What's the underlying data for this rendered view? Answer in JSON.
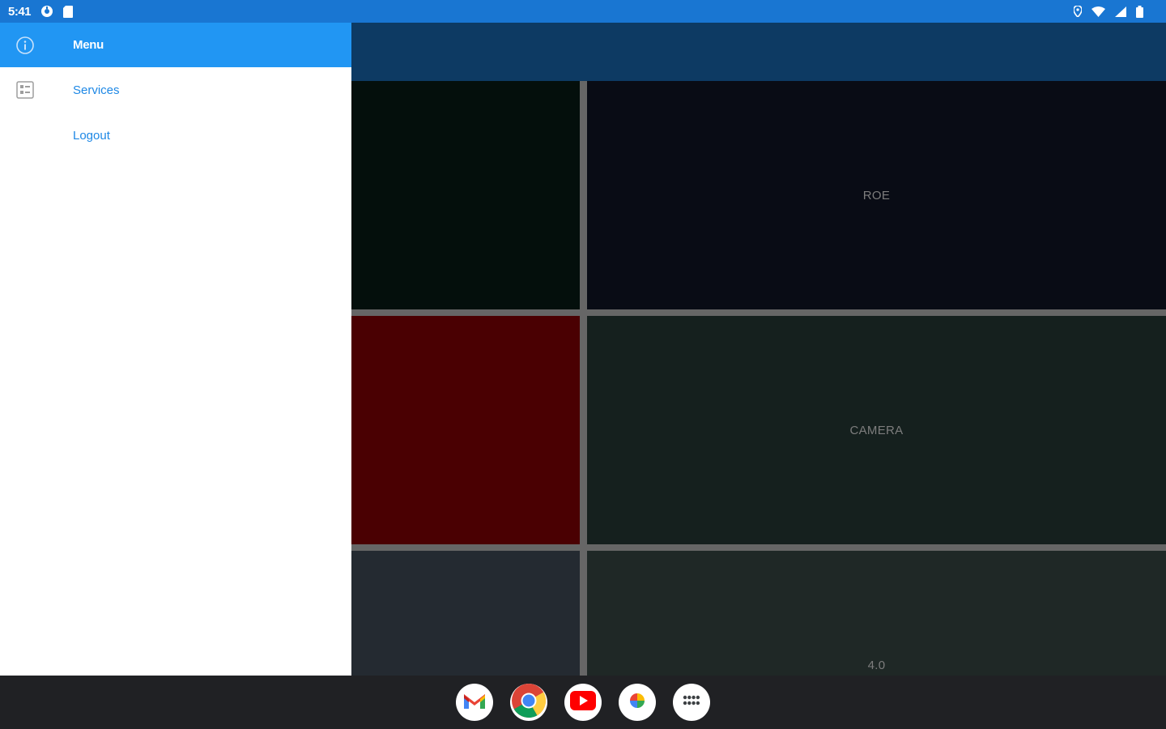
{
  "status_bar": {
    "time": "5:41",
    "icons_left": [
      "settings-notification-icon",
      "sim-card-icon"
    ],
    "icons_right": [
      "location-icon",
      "wifi-icon",
      "cellular-signal-icon",
      "battery-icon"
    ]
  },
  "drawer": {
    "header": {
      "icon": "info-icon",
      "label": "Menu"
    },
    "items": [
      {
        "icon": "grid-list-icon",
        "label": "Services"
      },
      {
        "icon": "",
        "label": "Logout"
      }
    ]
  },
  "tiles": [
    {
      "name": "tile-dark-green",
      "label": "",
      "color": "#040f0c"
    },
    {
      "name": "tile-roe",
      "label": "ROE",
      "color": "#090c15"
    },
    {
      "name": "tile-dark-red",
      "label": "",
      "color": "#4a0002"
    },
    {
      "name": "tile-camera",
      "label": "CAMERA",
      "color": "#15201e"
    },
    {
      "name": "tile-slate",
      "label": "",
      "color": "#242a31"
    },
    {
      "name": "tile-version",
      "label": "4.0",
      "color": "#1f2826"
    }
  ],
  "taskbar": {
    "apps": [
      {
        "name": "gmail-app",
        "icon": "gmail-icon"
      },
      {
        "name": "chrome-app",
        "icon": "chrome-icon"
      },
      {
        "name": "youtube-app",
        "icon": "youtube-icon"
      },
      {
        "name": "photos-app",
        "icon": "photos-icon"
      },
      {
        "name": "app-launcher",
        "icon": "app-launcher-icon"
      }
    ]
  },
  "colors": {
    "status_bar": "#1976d2",
    "drawer_header": "#2196f3",
    "app_bar": "#0d3a63",
    "drawer_link": "#1e88e5",
    "grid_divider": "#666666",
    "taskbar": "#202124"
  }
}
